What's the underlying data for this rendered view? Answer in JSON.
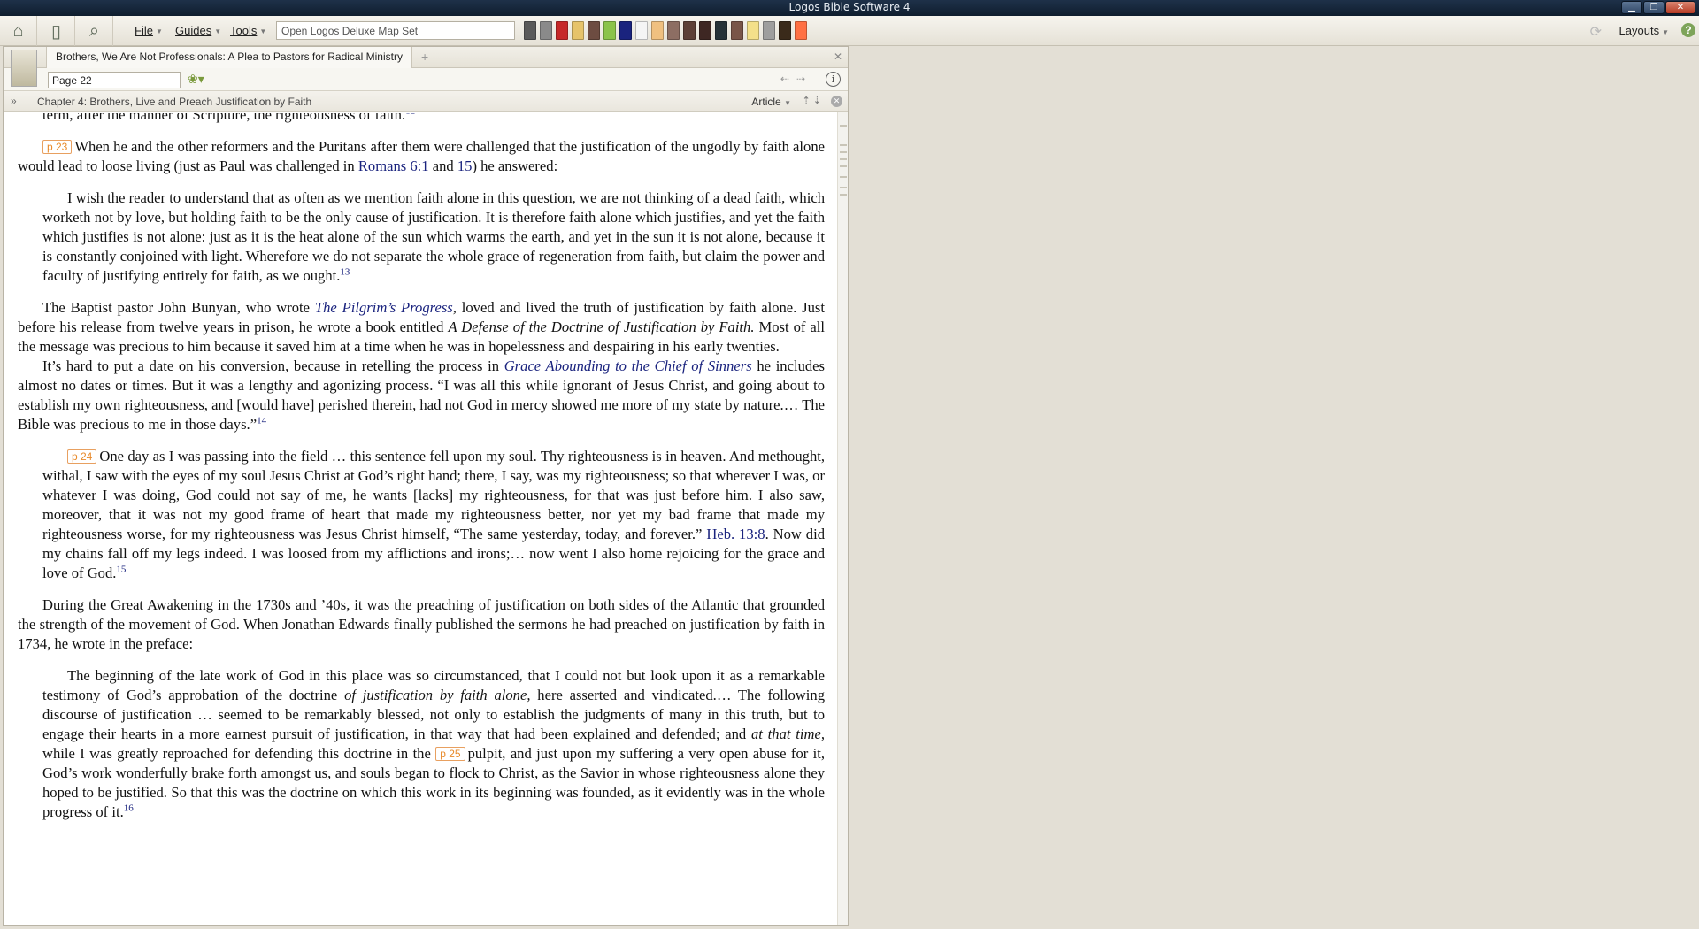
{
  "window": {
    "title": "Logos Bible Software 4"
  },
  "toolbar": {
    "menus": [
      {
        "label": "File"
      },
      {
        "label": "Guides"
      },
      {
        "label": "Tools"
      }
    ],
    "command_box_value": "Open Logos Deluxe Map Set",
    "layouts_label": "Layouts",
    "shelf_colors": [
      "#5a5a5a",
      "#8a8a8a",
      "#c62828",
      "#e6c36a",
      "#6d4c41",
      "#8bc34a",
      "#1a237e",
      "#f5f5f5",
      "#f0c080",
      "#8d6e63",
      "#5d4037",
      "#3e2723",
      "#263238",
      "#795548",
      "#f4e08a",
      "#9e9e9e",
      "#3a2a1a",
      "#ff7043"
    ]
  },
  "panel": {
    "tab_title": "Brothers, We Are Not Professionals: A Plea to Pastors for Radical Ministry",
    "page_value": "Page 22",
    "chapter": "Chapter 4: Brothers, Live and Preach Justification by Faith",
    "view_mode": "Article"
  },
  "text": {
    "p0": "term, after the manner of Scripture, the righteousness of faith.",
    "p0_sup": "12",
    "p1_marker": "p 23",
    "p1_a": "When he and the other reformers and the Puritans after them were challenged that the justification of the ungodly by faith alone would lead to loose living (just as Paul was challenged in ",
    "p1_link1": "Romans 6:1",
    "p1_b": " and ",
    "p1_link2": "15",
    "p1_c": ") he answered:",
    "q1": "I wish the reader to understand that as often as we mention faith alone in this question, we are not thinking of a dead faith, which worketh not by love, but holding faith to be the only cause of justification. It is therefore faith alone which justifies, and yet the faith which justifies is not alone: just as it is the heat alone of the sun which warms the earth, and yet in the sun it is not alone, because it is constantly conjoined with light. Wherefore we do not separate the whole grace of regeneration from faith, but claim the power and faculty of justifying entirely for faith, as we ought.",
    "q1_sup": "13",
    "p2_a": "The Baptist pastor John Bunyan, who wrote ",
    "p2_link": "The Pilgrim’s Progress",
    "p2_b": ", loved and lived the truth of justification by faith alone. Just before his release from twelve years in prison, he wrote a book entitled ",
    "p2_title": "A Defense of the Doctrine of Justification by Faith.",
    "p2_c": " Most of all the message was precious to him because it saved him at a time when he was in hopelessness and despairing in his early twenties.",
    "p3_a": "It’s hard to put a date on his conversion, because in retelling the process in ",
    "p3_link": "Grace Abounding to the Chief of Sinners",
    "p3_b": " he includes almost no dates or times. But it was a lengthy and agonizing process. “I was all this while ignorant of Jesus Christ, and going about to establish my own righteousness, and [would have] perished therein, had not God in mercy showed me more of my state by nature.… The Bible was precious to me in those days.”",
    "p3_sup": "14",
    "q2_marker": "p 24",
    "q2_a": "One day as I was passing into the field … this sentence fell upon my soul. Thy righteousness is in heaven. And methought, withal, I saw with the eyes of my soul Jesus Christ at God’s right hand; there, I say, was my righteousness; so that wherever I was, or whatever I was doing, God could not say of me, he wants [lacks] my righteousness, for that was just before him. I also saw, moreover, that it was not my good frame of heart that made my righteousness better, nor yet my bad frame that made my righteousness worse, for my righteousness was Jesus Christ himself, “The same yesterday, today, and forever.” ",
    "q2_link": "Heb. 13:8",
    "q2_b": ". Now did my chains fall off my legs indeed. I was loosed from my afflictions and irons;… now went I also home rejoicing for the grace and love of God.",
    "q2_sup": "15",
    "p4": "During the Great Awakening in the 1730s and ’40s, it was the preaching of justification on both sides of the Atlantic that grounded the strength of the movement of God. When Jonathan Edwards finally published the sermons he had preached on justification by faith in 1734, he wrote in the preface:",
    "q3_a": "The beginning of the late work of God in this place was so circumstanced, that I could not but look upon it as a remarkable testimony of God’s approbation of the doctrine ",
    "q3_em1": "of justification by faith alone,",
    "q3_b": " here asserted and vindicated.… The following discourse of justification … seemed to be remarkably blessed, not only to establish the judgments of many in this truth, but to engage their hearts in a more earnest pursuit of justification, in that way that had been explained and defended; and ",
    "q3_em2": "at that time,",
    "q3_c": " while I was greatly reproached for defending this doctrine in the ",
    "q3_marker": "p 25",
    "q3_d": "pulpit, and just upon my suffering a very open abuse for it, God’s work wonderfully brake forth amongst us, and souls began to flock to Christ, as the Savior in whose righteousness alone they hoped to be justified. So that this was the doctrine on which this work in its beginning was founded, as it evidently was in the whole progress of it.",
    "q3_sup": "16"
  }
}
